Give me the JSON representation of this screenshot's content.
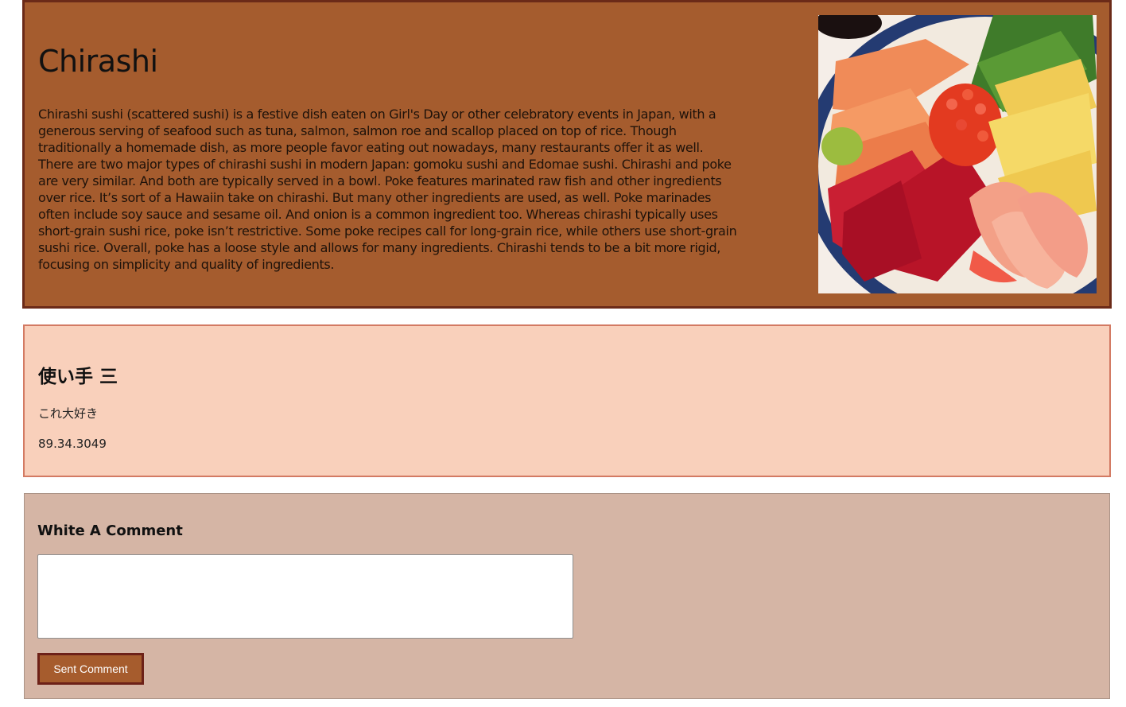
{
  "dish": {
    "title": "Chirashi",
    "description": "Chirashi sushi (scattered sushi) is a festive dish eaten on Girl's Day or other celebratory events in Japan, with a generous serving of seafood such as tuna, salmon, salmon roe and scallop placed on top of rice. Though traditionally a homemade dish, as more people favor eating out nowadays, many restaurants offer it as well. There are two major types of chirashi sushi in modern Japan: gomoku sushi and Edomae sushi. Chirashi and poke are very similar. And both are typically served in a bowl. Poke features marinated raw fish and other ingredients over rice. It’s sort of a Hawaiin take on chirashi. But many other ingredients are used, as well. Poke marinades often include soy sauce and sesame oil. And onion is a common ingredient too. Whereas chirashi typically uses short-grain sushi rice, poke isn’t restrictive. Some poke recipes call for long-grain rice, while others use short-grain sushi rice. Overall, poke has a loose style and allows for many ingredients. Chirashi tends to be a bit more rigid, focusing on simplicity and quality of ingredients."
  },
  "review": {
    "author": "使い手 三",
    "text": "これ大好き",
    "number": "89.34.3049"
  },
  "comment_form": {
    "heading": "White A Comment",
    "textarea_value": "",
    "submit_label": "Sent Comment"
  },
  "colors": {
    "hero_bg": "#a55c2e",
    "hero_border": "#6b2a18",
    "review_bg": "#f9d0bb",
    "review_border": "#d37a63",
    "form_bg": "#d5b5a5",
    "button_bg": "#a65c2d"
  }
}
